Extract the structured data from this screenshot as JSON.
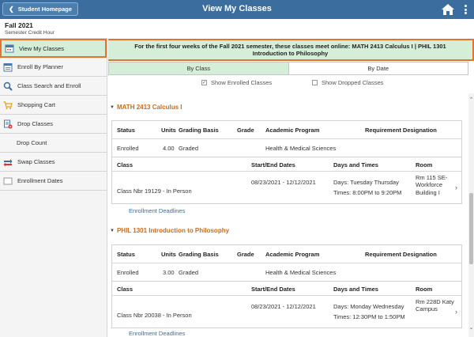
{
  "header": {
    "back_label": "Student Homepage",
    "title": "View My Classes"
  },
  "term": {
    "name": "Fall 2021",
    "unit": "Semester Credit Hour"
  },
  "sidebar": {
    "items": [
      {
        "label": "View My Classes",
        "icon": "calendar-icon",
        "active": true
      },
      {
        "label": "Enroll By Planner",
        "icon": "planner-icon"
      },
      {
        "label": "Class Search and Enroll",
        "icon": "search-icon"
      },
      {
        "label": "Shopping Cart",
        "icon": "cart-icon"
      },
      {
        "label": "Drop Classes",
        "icon": "drop-icon"
      },
      {
        "label": "Drop Count",
        "icon": ""
      },
      {
        "label": "Swap Classes",
        "icon": "swap-icon"
      },
      {
        "label": "Enrollment Dates",
        "icon": "dates-icon"
      }
    ]
  },
  "banner": {
    "text": "For the first four weeks of the Fall 2021 semester, these classes meet online: MATH 2413 Calculus I | PHIL 1301 Introduction to Philosophy"
  },
  "tabs": [
    {
      "label": "By Class",
      "active": true
    },
    {
      "label": "By Date",
      "active": false
    }
  ],
  "filters": {
    "enrolled_label": "Show Enrolled Classes",
    "enrolled_checked": true,
    "dropped_label": "Show Dropped Classes",
    "dropped_checked": false
  },
  "table_headers": {
    "status": "Status",
    "units": "Units",
    "grading": "Grading Basis",
    "grade": "Grade",
    "program": "Academic Program",
    "requirement": "Requirement Designation",
    "class": "Class",
    "dates": "Start/End Dates",
    "days": "Days and Times",
    "room": "Room"
  },
  "courses": [
    {
      "title": "MATH 2413 Calculus I",
      "status": "Enrolled",
      "units": "4.00",
      "grading": "Graded",
      "grade": "",
      "program": "Health & Medical Sciences",
      "requirement": "",
      "class": "Class Nbr 19129 - In Person",
      "dates": "08/23/2021 - 12/12/2021",
      "days": "Days: Tuesday Thursday",
      "times": "Times: 8:00PM to 9:20PM",
      "room": "Rm 115 SE-Workforce Building I",
      "deadlines": "Enrollment Deadlines"
    },
    {
      "title": "PHIL 1301 Introduction to Philosophy",
      "status": "Enrolled",
      "units": "3.00",
      "grading": "Graded",
      "grade": "",
      "program": "Health & Medical Sciences",
      "requirement": "",
      "class": "Class Nbr 20038 - In Person",
      "dates": "08/23/2021 - 12/12/2021",
      "days": "Days: Monday Wednesday",
      "times": "Times: 12:30PM to 1:50PM",
      "room": "Rm 228D Katy Campus",
      "deadlines": "Enrollment Deadlines"
    }
  ],
  "colors": {
    "header_bg": "#3b6e9e",
    "active_bg": "#d4eed8",
    "accent_border": "#e4732b",
    "course_title": "#c66c1c",
    "link": "#2f6fb0"
  }
}
